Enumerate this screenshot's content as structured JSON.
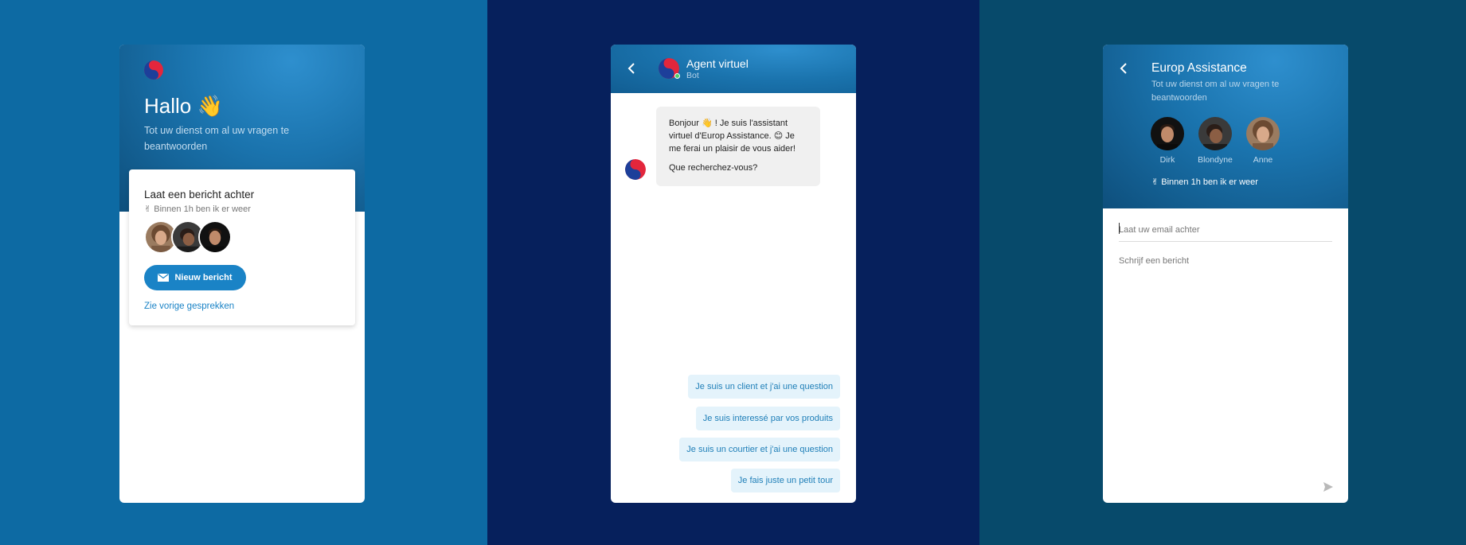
{
  "panels": {
    "welcome": {
      "greeting": "Hallo 👋",
      "subtitle": "Tot uw dienst om al uw vragen te beantwoorden",
      "card_title": "Laat een bericht achter",
      "response_time": "✌ Binnen 1h ben ik er weer",
      "new_message_button": "Nieuw bericht",
      "previous_link": "Zie vorige gesprekken"
    },
    "bot_chat": {
      "agent_name": "Agent virtuel",
      "agent_role": "Bot",
      "message_line1": "Bonjour 👋 ! Je suis l'assistant virtuel d'Europ Assistance. 😊  Je me ferai un plaisir de vous aider!",
      "message_line2": "Que recherchez-vous?",
      "quick_replies": [
        "Je suis un client et j'ai une question",
        "Je suis interessé par vos produits",
        "Je suis un courtier et j'ai une question",
        "Je fais juste un petit tour"
      ]
    },
    "contact_form": {
      "title": "Europ Assistance",
      "subtitle": "Tot uw dienst om al uw vragen te beantwoorden",
      "team": [
        {
          "name": "Dirk"
        },
        {
          "name": "Blondyne"
        },
        {
          "name": "Anne"
        }
      ],
      "response_time": "✌ Binnen 1h ben ik er weer",
      "email_placeholder": "Laat uw email achter",
      "message_placeholder": "Schrijf een bericht"
    }
  },
  "colors": {
    "left_background": "#0d6aa3",
    "middle_background": "#06205c",
    "right_background": "#074a6b",
    "accent": "#1a83c6",
    "quick_reply_bg": "#e4f3fb"
  }
}
